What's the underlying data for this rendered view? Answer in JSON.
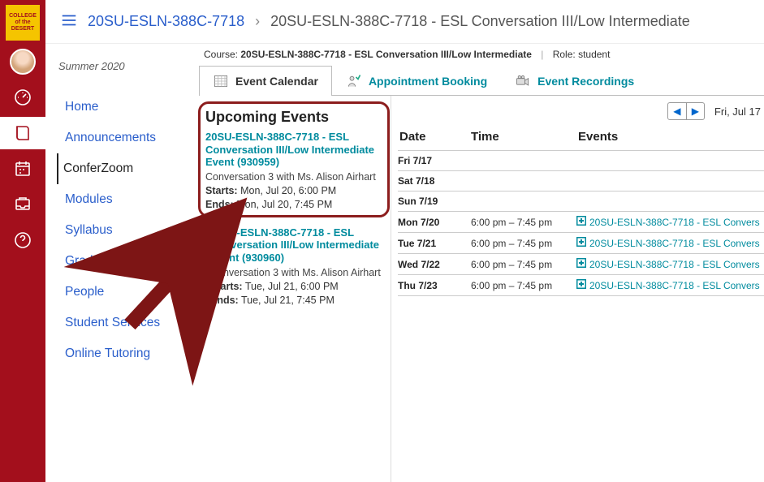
{
  "logo_text": "COLLEGE of the DESERT",
  "breadcrumb": {
    "course": "20SU-ESLN-388C-7718",
    "page": "20SU-ESLN-388C-7718 - ESL Conversation III/Low Intermediate"
  },
  "term": "Summer 2020",
  "course_nav": [
    "Home",
    "Announcements",
    "ConferZoom",
    "Modules",
    "Syllabus",
    "Grades",
    "People",
    "Student Services",
    "Online Tutoring"
  ],
  "active_nav": "ConferZoom",
  "tool_header": {
    "course_prefix": "Course: ",
    "course": "20SU-ESLN-388C-7718 - ESL Conversation III/Low Intermediate",
    "role_prefix": "Role: ",
    "role": "student"
  },
  "tabs": {
    "calendar": "Event Calendar",
    "appointment": "Appointment Booking",
    "recordings": "Event Recordings"
  },
  "upcoming_heading": "Upcoming Events",
  "events": [
    {
      "title": "20SU-ESLN-388C-7718 - ESL Conversation III/Low Intermediate Event (930959)",
      "sub": "Conversation 3 with Ms. Alison Airhart",
      "starts_label": "Starts:",
      "starts": "Mon, Jul 20, 6:00 PM",
      "ends_label": "Ends:",
      "ends": "Mon, Jul 20, 7:45 PM"
    },
    {
      "title": "20SU-ESLN-388C-7718 - ESL Conversation III/Low Intermediate Event (930960)",
      "sub": "Conversation 3 with Ms. Alison Airhart",
      "starts_label": "Starts:",
      "starts": "Tue, Jul 21, 6:00 PM",
      "ends_label": "Ends:",
      "ends": "Tue, Jul 21, 7:45 PM"
    }
  ],
  "calendar": {
    "current_date": "Fri, Jul 17",
    "headers": {
      "date": "Date",
      "time": "Time",
      "events": "Events"
    },
    "rows": [
      {
        "date": "Fri 7/17",
        "time": "",
        "event": ""
      },
      {
        "date": "Sat 7/18",
        "time": "",
        "event": ""
      },
      {
        "date": "Sun 7/19",
        "time": "",
        "event": ""
      },
      {
        "date": "Mon 7/20",
        "time": "6:00 pm – 7:45 pm",
        "event": "20SU-ESLN-388C-7718 - ESL Convers"
      },
      {
        "date": "Tue 7/21",
        "time": "6:00 pm – 7:45 pm",
        "event": "20SU-ESLN-388C-7718 - ESL Convers"
      },
      {
        "date": "Wed 7/22",
        "time": "6:00 pm – 7:45 pm",
        "event": "20SU-ESLN-388C-7718 - ESL Convers"
      },
      {
        "date": "Thu 7/23",
        "time": "6:00 pm – 7:45 pm",
        "event": "20SU-ESLN-388C-7718 - ESL Convers"
      }
    ]
  }
}
